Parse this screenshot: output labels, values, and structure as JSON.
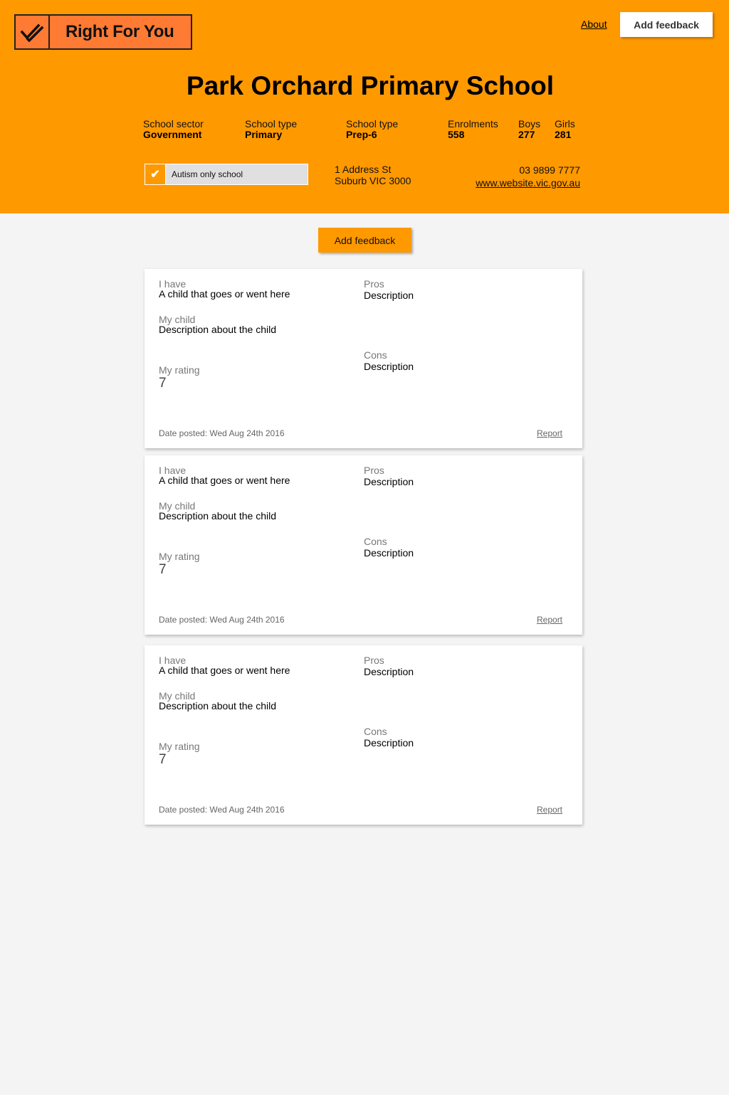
{
  "header": {
    "logo_text": "Right For You",
    "about_label": "About",
    "add_feedback_label": "Add feedback",
    "brand_color": "#ff9900"
  },
  "school": {
    "name": "Park Orchard Primary School",
    "stats": [
      {
        "label": "School sector",
        "value": "Government"
      },
      {
        "label": "School type",
        "value": "Primary"
      },
      {
        "label": "School type",
        "value": "Prep-6"
      },
      {
        "label": "Enrolments",
        "value": "558"
      },
      {
        "label": "Boys",
        "value": "277"
      },
      {
        "label": "Girls",
        "value": "281"
      }
    ],
    "autism_label": "Autism only school",
    "autism_checked": true,
    "address_line1": "1 Address St",
    "address_line2": "Suburb VIC 3000",
    "phone": "03 9899 7777",
    "website": "www.website.vic.gov.au"
  },
  "main": {
    "add_feedback_label": "Add feedback"
  },
  "reviews": [
    {
      "i_have_label": "I have",
      "i_have_value": "A child that goes or went here",
      "my_child_label": "My child",
      "my_child_value": "Description about the child",
      "rating_label": "My rating",
      "rating_value": "7",
      "pros_label": "Pros",
      "pros_value": "Description",
      "cons_label": "Cons",
      "cons_value": "Description",
      "date": "Date posted: Wed Aug 24th 2016",
      "report_label": "Report"
    },
    {
      "i_have_label": "I have",
      "i_have_value": "A child that goes or went here",
      "my_child_label": "My child",
      "my_child_value": "Description about the child",
      "rating_label": "My rating",
      "rating_value": "7",
      "pros_label": "Pros",
      "pros_value": "Description",
      "cons_label": "Cons",
      "cons_value": "Description",
      "date": "Date posted: Wed Aug 24th 2016",
      "report_label": "Report"
    },
    {
      "i_have_label": "I have",
      "i_have_value": "A child that goes or went here",
      "my_child_label": "My child",
      "my_child_value": "Description about the child",
      "rating_label": "My rating",
      "rating_value": "7",
      "pros_label": "Pros",
      "pros_value": "Description",
      "cons_label": "Cons",
      "cons_value": "Description",
      "date": "Date posted: Wed Aug 24th 2016",
      "report_label": "Report"
    }
  ]
}
